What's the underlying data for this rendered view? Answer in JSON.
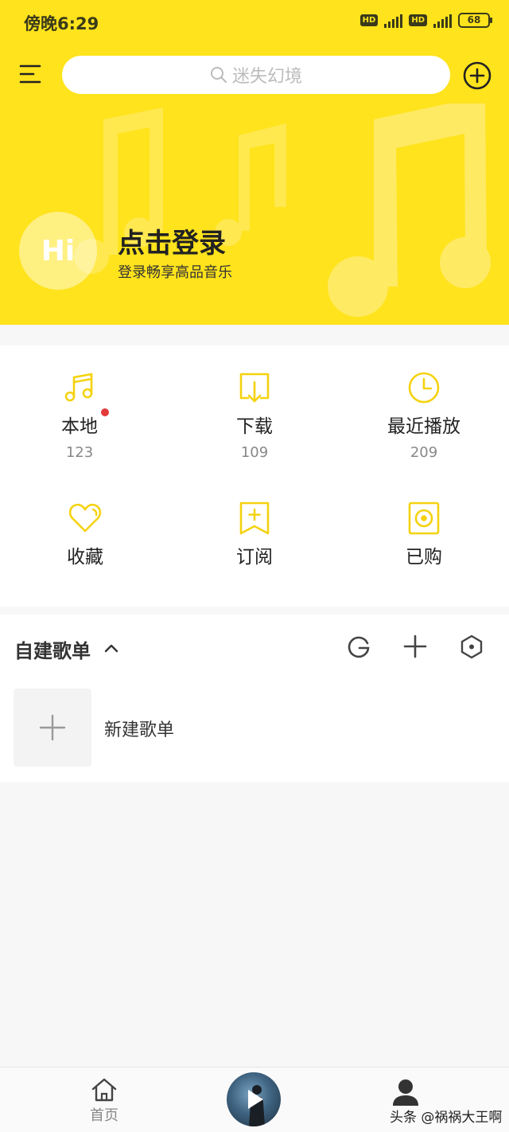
{
  "status_bar": {
    "time": "傍晚6:29",
    "battery": "68",
    "network": "4G",
    "hd": "HD"
  },
  "header": {
    "search_placeholder": "迷失幻境"
  },
  "profile": {
    "avatar_text": "Hi",
    "login_title": "点击登录",
    "login_subtitle": "登录畅享高品音乐"
  },
  "quick_access": [
    {
      "label": "本地",
      "count": "123",
      "icon": "music-note-icon"
    },
    {
      "label": "下载",
      "count": "109",
      "icon": "download-icon"
    },
    {
      "label": "最近播放",
      "count": "209",
      "icon": "clock-icon"
    },
    {
      "label": "收藏",
      "icon": "heart-icon"
    },
    {
      "label": "订阅",
      "icon": "bookmark-plus-icon"
    },
    {
      "label": "已购",
      "icon": "disc-icon"
    }
  ],
  "playlists": {
    "section_title": "自建歌单",
    "new_playlist_label": "新建歌单"
  },
  "bottom_nav": {
    "home_label": "首页",
    "watermark": "头条 @祸祸大王啊"
  },
  "colors": {
    "brand_yellow": "#ffe31c",
    "icon_yellow": "#f5d20f",
    "notification_red": "#e23a3a"
  }
}
